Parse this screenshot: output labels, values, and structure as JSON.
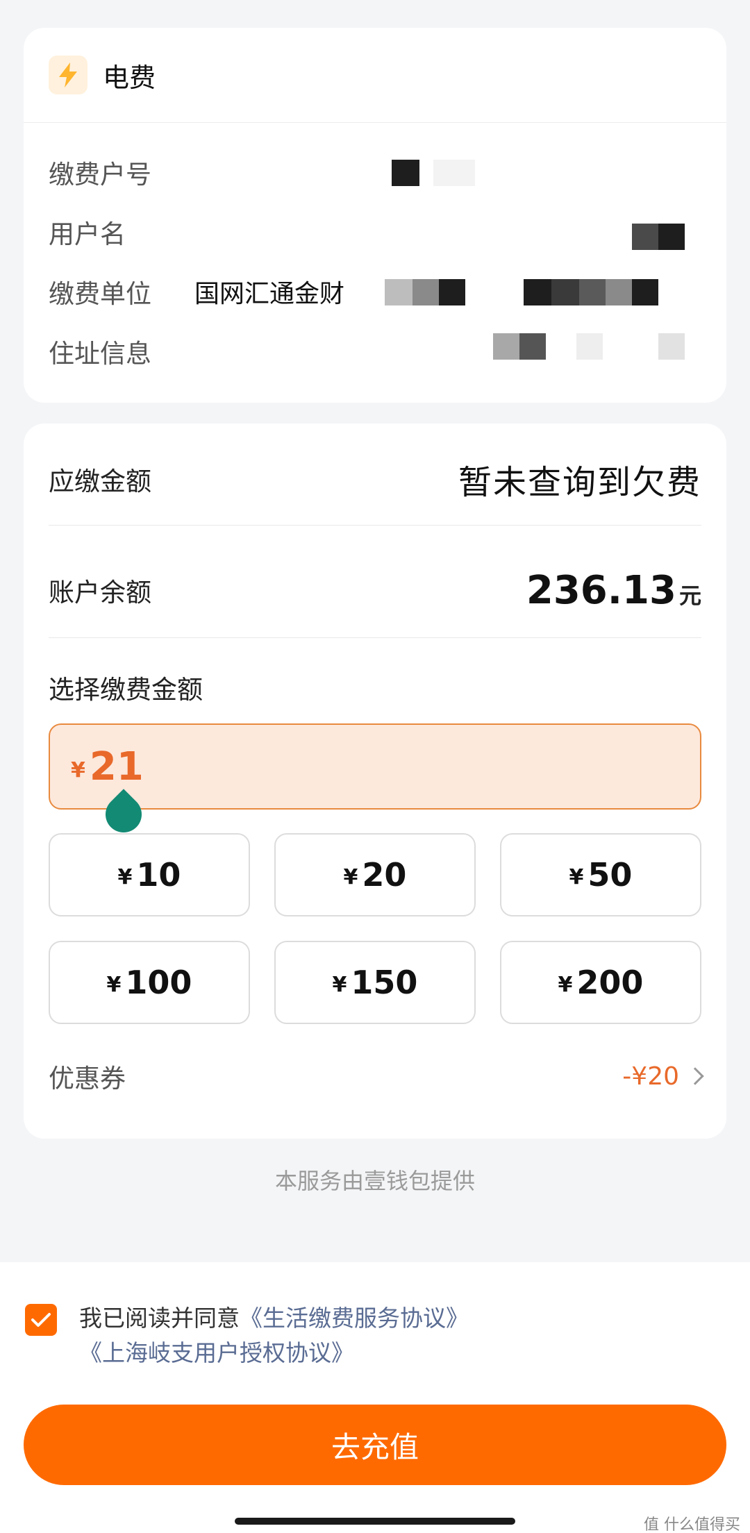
{
  "header": {
    "title": "电费",
    "icon": "lightning-bolt-icon"
  },
  "account_info": {
    "rows": [
      {
        "label": "缴费户号",
        "value": ""
      },
      {
        "label": "用户名",
        "value": ""
      },
      {
        "label": "缴费单位",
        "value": "国网汇通金财"
      },
      {
        "label": "住址信息",
        "value": ""
      }
    ]
  },
  "payment": {
    "due_label": "应缴金额",
    "due_value": "暂未查询到欠费",
    "balance_label": "账户余额",
    "balance_value": "236.13",
    "balance_unit": "元",
    "select_label": "选择缴费金额",
    "input": {
      "currency": "¥",
      "value": "21"
    },
    "presets": [
      {
        "currency": "¥",
        "value": "10"
      },
      {
        "currency": "¥",
        "value": "20"
      },
      {
        "currency": "¥",
        "value": "50"
      },
      {
        "currency": "¥",
        "value": "100"
      },
      {
        "currency": "¥",
        "value": "150"
      },
      {
        "currency": "¥",
        "value": "200"
      }
    ],
    "coupon_label": "优惠券",
    "coupon_value": "-¥20"
  },
  "provider_note": "本服务由壹钱包提供",
  "agreement": {
    "prefix": "我已阅读并同意",
    "link1": "《生活缴费服务协议》",
    "link2": "《上海岐支用户授权协议》",
    "checked": true
  },
  "submit_label": "去充值",
  "watermark": "值 什么值得买",
  "colors": {
    "accent": "#ff6a00",
    "input_bg": "#fde8dc",
    "handle": "#138a74",
    "link": "#5a6c93"
  }
}
